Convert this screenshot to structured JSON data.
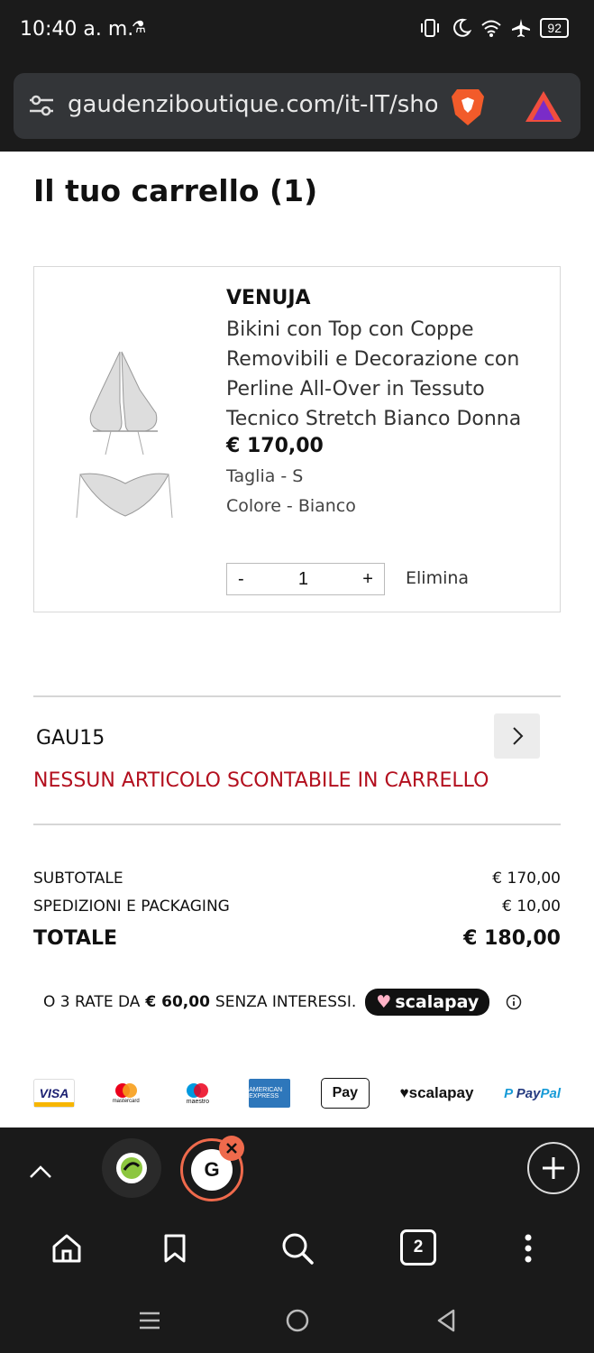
{
  "status_bar": {
    "time": "10:40 a. m.",
    "battery": "92"
  },
  "browser": {
    "url": "gaudenziboutique.com/it-IT/shop/cart",
    "tab_count": "2"
  },
  "page": {
    "title": "Il tuo carrello (1)"
  },
  "cart_item": {
    "brand": "VENUJA",
    "name": "Bikini con Top con Coppe Removibili e Decorazione con Perline All-Over in Tessuto Tecnico Stretch Bianco Donna",
    "price": "€ 170,00",
    "size": "Taglia - S",
    "color": "Colore - Bianco",
    "qty_minus": "-",
    "quantity": "1",
    "qty_plus": "+",
    "remove_label": "Elimina"
  },
  "coupon": {
    "code": "GAU15",
    "error": "NESSUN ARTICOLO SCONTABILE IN CARRELLO"
  },
  "summary": {
    "subtotal_label": "SUBTOTALE",
    "subtotal_value": "€ 170,00",
    "shipping_label": "SPEDIZIONI E PACKAGING",
    "shipping_value": "€ 10,00",
    "total_label": "TOTALE",
    "total_value": "€ 180,00"
  },
  "installments": {
    "prefix": "O 3 RATE DA",
    "amount": "€ 60,00",
    "suffix": "SENZA INTERESSI.",
    "provider": "scalapay"
  },
  "payment_methods": {
    "visa": "VISA",
    "mastercard": "mastercard",
    "maestro": "maestro",
    "amex": "AMERICAN EXPRESS",
    "applepay": "Pay",
    "scalapay": "scalapay",
    "paypal_a": "Pay",
    "paypal_b": "Pal"
  },
  "colors": {
    "error_red": "#b30f1e",
    "browser_dark": "#1a1a1a",
    "active_tab_ring": "#ef6a4c"
  }
}
